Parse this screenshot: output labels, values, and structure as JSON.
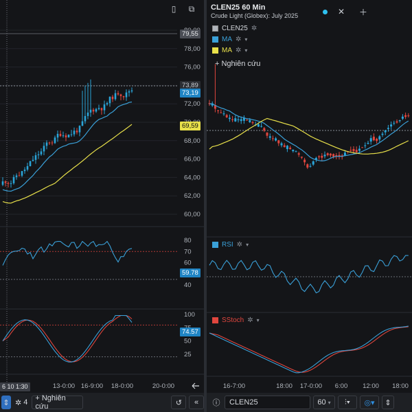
{
  "left": {
    "price_ticks": [
      "80,00",
      "78,00",
      "76,00",
      "74,00",
      "72,00",
      "70,00",
      "68,00",
      "66,00",
      "64,00",
      "62,00",
      "60,00"
    ],
    "tags": {
      "high": "79,55",
      "last": "73,89",
      "close": "73,19",
      "ma_long": "69,59"
    },
    "rsi_ticks": [
      "80",
      "70",
      "60",
      "50",
      "40"
    ],
    "rsi_value": "59.78",
    "stoch_ticks": [
      "100",
      "75",
      "50",
      "25"
    ],
    "stoch_value": "74.57",
    "x_labels": [
      "13-0:00",
      "16-9:00",
      "18-0:00",
      "20-0:00"
    ],
    "cursor_label": "6 10 1:30",
    "footer": {
      "count": "4",
      "research": "+ Nghiên cứu"
    }
  },
  "right": {
    "title": "CLEN25 60 Min",
    "subtitle": "Crude Light (Globex): July 2025",
    "legend": [
      {
        "name": "CLEN25",
        "color": "#b0b4ba"
      },
      {
        "name": "MA",
        "color": "#3aa0d8"
      },
      {
        "name": "MA",
        "color": "#e8e04a"
      }
    ],
    "research": "+ Nghiên cứu",
    "rsi_label": "RSI",
    "stoch_label": "SStoch",
    "x_labels": [
      "16-7:00",
      "18:00",
      "17-0:00",
      "6:00",
      "12:00",
      "18:00"
    ],
    "footer": {
      "symbol": "CLEN25",
      "interval": "60"
    }
  },
  "colors": {
    "up": "#2aa5d9",
    "down": "#e0463e",
    "ma_short": "#3aa0d8",
    "ma_long": "#e8e04a",
    "rsi": "#3aa0d8",
    "stoch_k": "#3aa0d8",
    "stoch_d": "#e0463e"
  }
}
